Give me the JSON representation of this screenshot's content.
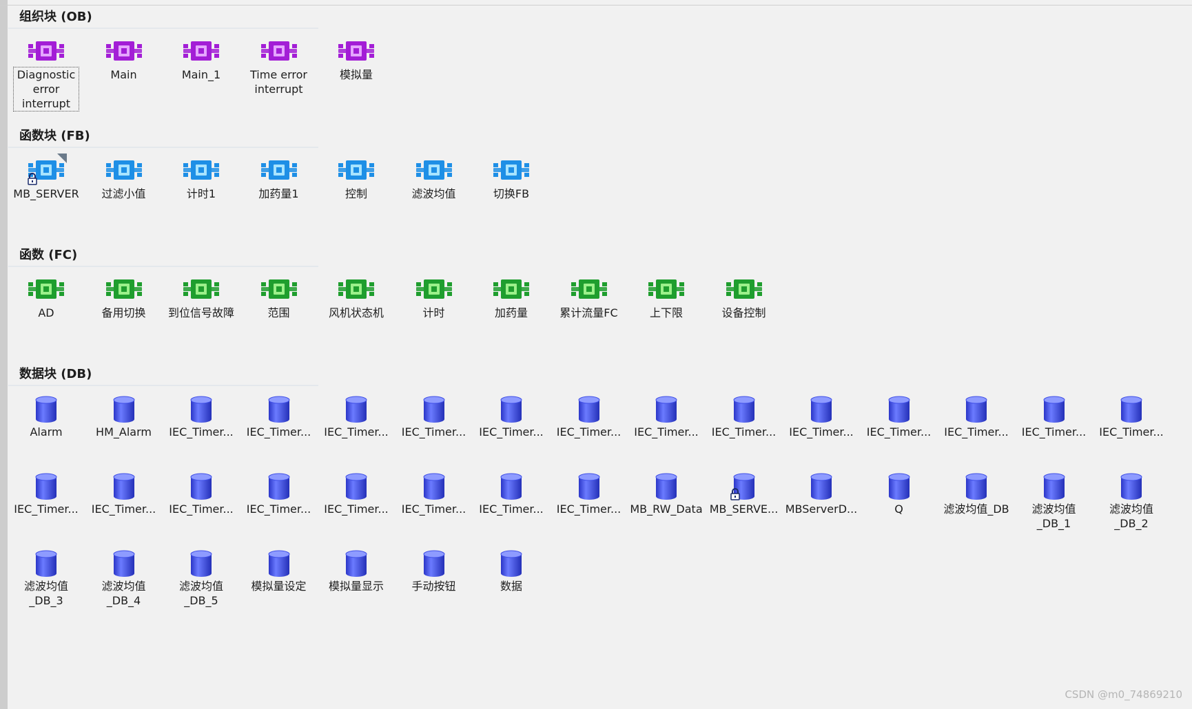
{
  "colors": {
    "ob": "#a31ed6",
    "fb": "#1e8fe6",
    "fc": "#1f9e2e",
    "db": "#3f4fe6"
  },
  "sections": {
    "ob": {
      "title": "组织块 (OB)",
      "icon": "ob-block-icon",
      "items": [
        {
          "label": "Diagnostic error interrupt",
          "selected": true
        },
        {
          "label": "Main"
        },
        {
          "label": "Main_1"
        },
        {
          "label": "Time error interrupt"
        },
        {
          "label": "模拟量"
        }
      ]
    },
    "fb": {
      "title": "函数块 (FB)",
      "icon": "fb-block-icon",
      "items": [
        {
          "label": "MB_SERVER",
          "locked": true,
          "library": true
        },
        {
          "label": "过滤小值"
        },
        {
          "label": "计时1"
        },
        {
          "label": "加药量1"
        },
        {
          "label": "控制"
        },
        {
          "label": "滤波均值"
        },
        {
          "label": "切换FB"
        }
      ]
    },
    "fc": {
      "title": "函数 (FC)",
      "icon": "fc-block-icon",
      "items": [
        {
          "label": "AD"
        },
        {
          "label": "备用切换"
        },
        {
          "label": "到位信号故障"
        },
        {
          "label": "范围"
        },
        {
          "label": "风机状态机"
        },
        {
          "label": "计时"
        },
        {
          "label": "加药量"
        },
        {
          "label": "累计流量FC"
        },
        {
          "label": "上下限"
        },
        {
          "label": "设备控制"
        }
      ]
    },
    "db": {
      "title": "数据块 (DB)",
      "icon": "db-cylinder-icon",
      "items": [
        {
          "label": "Alarm"
        },
        {
          "label": "HM_Alarm"
        },
        {
          "label": "IEC_Timer..."
        },
        {
          "label": "IEC_Timer..."
        },
        {
          "label": "IEC_Timer..."
        },
        {
          "label": "IEC_Timer..."
        },
        {
          "label": "IEC_Timer..."
        },
        {
          "label": "IEC_Timer..."
        },
        {
          "label": "IEC_Timer..."
        },
        {
          "label": "IEC_Timer..."
        },
        {
          "label": "IEC_Timer..."
        },
        {
          "label": "IEC_Timer..."
        },
        {
          "label": "IEC_Timer..."
        },
        {
          "label": "IEC_Timer..."
        },
        {
          "label": "IEC_Timer..."
        },
        {
          "label": "IEC_Timer..."
        },
        {
          "label": "IEC_Timer..."
        },
        {
          "label": "IEC_Timer..."
        },
        {
          "label": "IEC_Timer..."
        },
        {
          "label": "IEC_Timer..."
        },
        {
          "label": "IEC_Timer..."
        },
        {
          "label": "IEC_Timer..."
        },
        {
          "label": "IEC_Timer..."
        },
        {
          "label": "MB_RW_Data"
        },
        {
          "label": "MB_SERVE...",
          "locked": true
        },
        {
          "label": "MBServerD..."
        },
        {
          "label": "Q"
        },
        {
          "label": "滤波均值_DB"
        },
        {
          "label": "滤波均值_DB_1"
        },
        {
          "label": "滤波均值_DB_2"
        },
        {
          "label": "滤波均值_DB_3"
        },
        {
          "label": "滤波均值_DB_4"
        },
        {
          "label": "滤波均值_DB_5"
        },
        {
          "label": "模拟量设定"
        },
        {
          "label": "模拟量显示"
        },
        {
          "label": "手动按钮"
        },
        {
          "label": "数据"
        }
      ]
    }
  },
  "watermark": "CSDN @m0_74869210"
}
